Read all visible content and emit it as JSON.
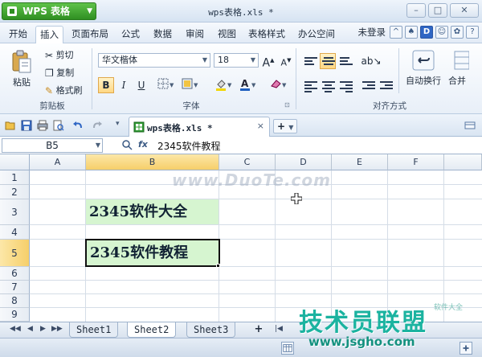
{
  "app": {
    "name": "WPS 表格",
    "document_title": "wps表格.xls *"
  },
  "window_controls": {
    "minimize": "–",
    "maximize": "□",
    "close": "✕"
  },
  "menu": {
    "tabs": [
      "开始",
      "插入",
      "页面布局",
      "公式",
      "数据",
      "审阅",
      "视图",
      "表格样式",
      "办公空间"
    ],
    "active_tab": "开始",
    "login": "未登录"
  },
  "ribbon": {
    "clipboard": {
      "paste": "粘贴",
      "cut": "剪切",
      "copy": "复制",
      "format_painter": "格式刷",
      "label": "剪贴板"
    },
    "font": {
      "name": "华文楷体",
      "size": "18",
      "grow": "A",
      "shrink": "A",
      "bold": "B",
      "italic": "I",
      "underline": "U",
      "label": "字体"
    },
    "alignment": {
      "wrap_text": "自动换行",
      "merge": "合并",
      "label": "对齐方式"
    }
  },
  "doc_tab": {
    "label": "wps表格.xls *",
    "close": "×",
    "new_tab": "+"
  },
  "formula_bar": {
    "cell_ref": "B5",
    "fx": "fx",
    "content": "2345软件教程"
  },
  "sheet": {
    "columns": [
      "A",
      "B",
      "C",
      "D",
      "E",
      "F"
    ],
    "rows": [
      "1",
      "2",
      "3",
      "4",
      "5",
      "6",
      "7",
      "8",
      "9"
    ],
    "selected_column": "B",
    "selected_row": "5",
    "cells": {
      "B3": "2345软件大全",
      "B5": "2345软件教程"
    },
    "watermark": "www.DuoTe.com"
  },
  "sheet_tabs": [
    "Sheet1",
    "Sheet2",
    "Sheet3"
  ],
  "active_sheet": "Sheet2",
  "overlay": {
    "brand": "技术员联盟",
    "url": "www.jsgho.com",
    "sub": "软件大全"
  },
  "colors": {
    "accent_green": "#2f8f22",
    "cell_fill": "#d6f5d0",
    "selection_header": "#f6cf6a",
    "brand": "#1bb3a0"
  }
}
